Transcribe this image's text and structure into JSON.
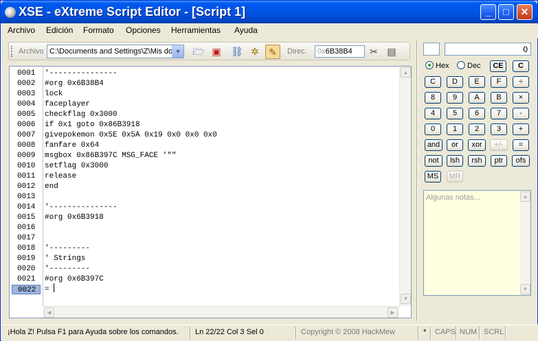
{
  "window": {
    "title": "XSE - eXtreme Script Editor - [Script 1]"
  },
  "menu": [
    "Archivo",
    "Edición",
    "Formato",
    "Opciones",
    "Herramientas",
    "Ayuda"
  ],
  "toolbar": {
    "archivo_label": "Archivo",
    "path_value": "C:\\Documents and Settings\\Z\\Mis do",
    "direc_label": "Direc.",
    "direc_prefix": "0x",
    "direc_value": "6B38B4"
  },
  "editor": {
    "line_numbers": [
      "0001",
      "0002",
      "0003",
      "0004",
      "0005",
      "0006",
      "0007",
      "0008",
      "0009",
      "0010",
      "0011",
      "0012",
      "0013",
      "0014",
      "0015",
      "0016",
      "0017",
      "0018",
      "0019",
      "0020",
      "0021",
      "0022"
    ],
    "lines": [
      "'---------------",
      "#org 0x6B38B4",
      "lock",
      "faceplayer",
      "checkflag 0x3000",
      "if 0x1 goto 0x86B3918",
      "givepokemon 0x5E 0x5A 0x19 0x0 0x0 0x0",
      "fanfare 0x64",
      "msgbox 0x86B397C MSG_FACE '\"\"",
      "setflag 0x3000",
      "release",
      "end",
      "",
      "'---------------",
      "#org 0x6B3918",
      "",
      "",
      "'---------",
      "' Strings",
      "'---------",
      "#org 0x6B397C",
      "= "
    ],
    "current_line": "0022"
  },
  "calculator": {
    "display": "0",
    "radio_hex": "Hex",
    "radio_dec": "Dec",
    "selected_base": "Hex",
    "buttons": {
      "ce": "CE",
      "c_clear": "C",
      "c": "C",
      "d": "D",
      "e": "E",
      "f": "F",
      "div": "÷",
      "b8": "8",
      "b9": "9",
      "a": "A",
      "b": "B",
      "mul": "×",
      "b4": "4",
      "b5": "5",
      "b6": "6",
      "b7": "7",
      "sub": "-",
      "b0": "0",
      "b1": "1",
      "b2": "2",
      "b3": "3",
      "add": "+",
      "and": "and",
      "or": "or",
      "xor": "xor",
      "plusminus": "+/-",
      "eq": "=",
      "not": "not",
      "lsh": "lsh",
      "rsh": "rsh",
      "ptr": "ptr",
      "ofs": "ofs",
      "ms": "MS",
      "mr": "MR"
    }
  },
  "notes": {
    "placeholder": "Algunas notas..."
  },
  "status": {
    "help": "¡Hola Z! Pulsa F1 para Ayuda sobre los comandos.",
    "position": "Ln 22/22  Col 3  Sel 0",
    "copyright": "Copyright © 2008 HackMew",
    "modified": "*",
    "caps": "CAPS",
    "num": "NUM",
    "scrl": "SCRL"
  }
}
